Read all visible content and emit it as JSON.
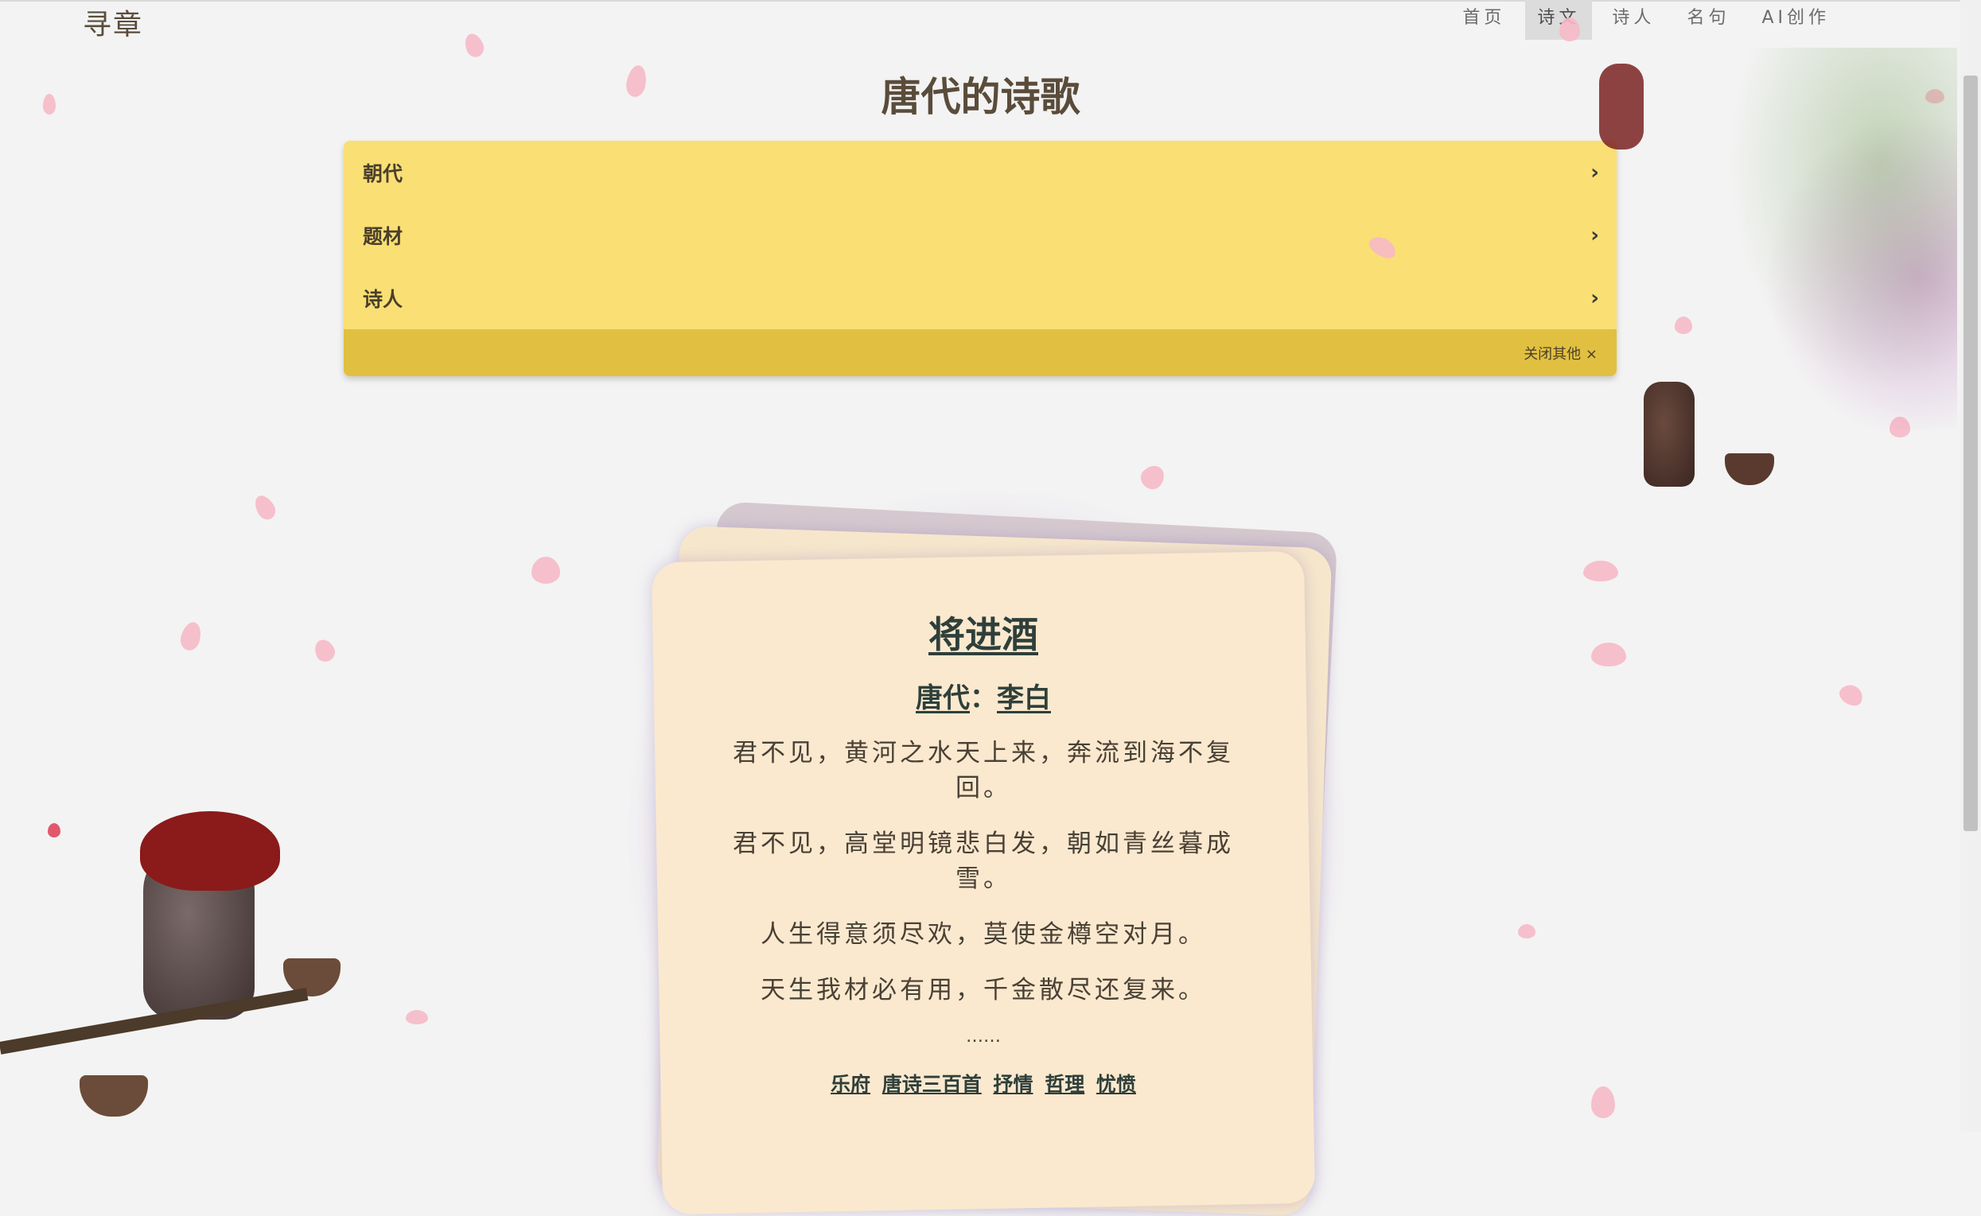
{
  "header": {
    "logo": "寻章",
    "nav": [
      {
        "label": "首页",
        "active": false
      },
      {
        "label": "诗文",
        "active": true
      },
      {
        "label": "诗人",
        "active": false
      },
      {
        "label": "名句",
        "active": false
      },
      {
        "label": "AI创作",
        "active": false
      }
    ]
  },
  "page": {
    "title": "唐代的诗歌"
  },
  "filters": {
    "rows": [
      {
        "label": "朝代"
      },
      {
        "label": "题材"
      },
      {
        "label": "诗人"
      }
    ],
    "close_label": "关闭其他 ×"
  },
  "poem": {
    "title": "将进酒",
    "dynasty": "唐代",
    "separator": "：",
    "author": "李白",
    "lines": [
      "君不见，黄河之水天上来，奔流到海不复回。",
      "君不见，高堂明镜悲白发，朝如青丝暮成雪。",
      "人生得意须尽欢，莫使金樽空对月。",
      "天生我材必有用，千金散尽还复来。"
    ],
    "ellipsis": "……",
    "tags": [
      "乐府",
      "唐诗三百首",
      "抒情",
      "哲理",
      "忧愤"
    ]
  },
  "colors": {
    "accordion": "#f9df74",
    "accordion_footer": "#e1c041",
    "card": "#fae9cf",
    "text_dark": "#2f3f3a",
    "petal": "#f6b9c8"
  }
}
